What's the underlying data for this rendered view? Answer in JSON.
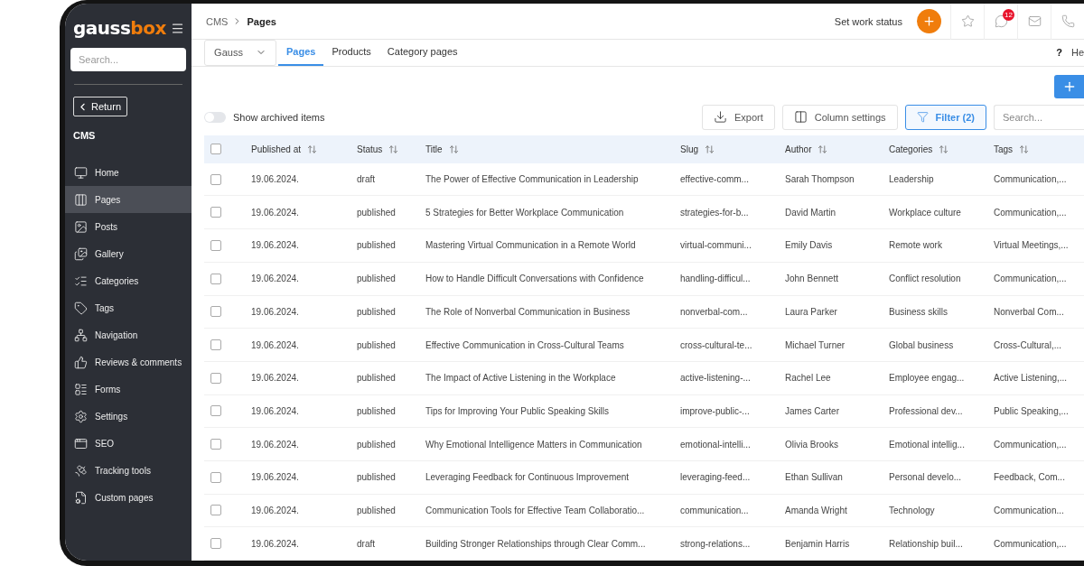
{
  "logo": {
    "text": "gauss",
    "accent": "box"
  },
  "sidebar": {
    "search": {
      "placeholder": "Search..."
    },
    "return_button": "Return",
    "section": "CMS",
    "items": [
      {
        "label": "Home",
        "selected": false
      },
      {
        "label": "Pages",
        "selected": true
      },
      {
        "label": "Posts",
        "selected": false
      },
      {
        "label": "Gallery",
        "selected": false
      },
      {
        "label": "Categories",
        "selected": false
      },
      {
        "label": "Tags",
        "selected": false
      },
      {
        "label": "Navigation",
        "selected": false
      },
      {
        "label": "Reviews & comments",
        "selected": false
      },
      {
        "label": "Forms",
        "selected": false
      },
      {
        "label": "Settings",
        "selected": false
      },
      {
        "label": "SEO",
        "selected": false
      },
      {
        "label": "Tracking tools",
        "selected": false
      },
      {
        "label": "Custom pages",
        "selected": false
      }
    ]
  },
  "breadcrumb": [
    "CMS",
    "Pages"
  ],
  "topbar": {
    "work_status": "Set work status",
    "messages_badge": "12"
  },
  "site_dropdown": {
    "value": "Gauss"
  },
  "tabs": [
    {
      "label": "Pages",
      "selected": true
    },
    {
      "label": "Products",
      "selected": false
    },
    {
      "label": "Category pages",
      "selected": false
    }
  ],
  "help": {
    "icon_text": "?",
    "label": "He"
  },
  "toolbar": {
    "archived_toggle": {
      "label": "Show archived items",
      "on": false
    },
    "export": "Export",
    "column_settings": "Column settings",
    "filter": {
      "label": "Filter (2)",
      "active": true
    },
    "search": {
      "placeholder": "Search..."
    }
  },
  "table": {
    "select_all": {
      "checked": false
    },
    "columns": [
      "Published at",
      "Status",
      "Title",
      "Slug",
      "Author",
      "Categories",
      "Tags"
    ],
    "rows": [
      {
        "checked": false,
        "cells": [
          "19.06.2024.",
          "draft",
          "The Power of Effective Communication in Leadership",
          "effective-comm...",
          "Sarah Thompson",
          "Leadership",
          "Communication,..."
        ]
      },
      {
        "checked": false,
        "cells": [
          "19.06.2024.",
          "published",
          "5 Strategies for Better Workplace Communication",
          "strategies-for-b...",
          "David Martin",
          "Workplace culture",
          "Communication,..."
        ]
      },
      {
        "checked": false,
        "cells": [
          "19.06.2024.",
          "published",
          "Mastering Virtual Communication in a Remote World",
          "virtual-communi...",
          "Emily Davis",
          "Remote work",
          "Virtual Meetings,..."
        ]
      },
      {
        "checked": false,
        "cells": [
          "19.06.2024.",
          "published",
          "How to Handle Difficult Conversations with Confidence",
          "handling-difficul...",
          "John Bennett",
          "Conflict resolution",
          "Communication,..."
        ]
      },
      {
        "checked": false,
        "cells": [
          "19.06.2024.",
          "published",
          "The Role of Nonverbal Communication in Business",
          "nonverbal-com...",
          "Laura Parker",
          "Business skills",
          "Nonverbal Com..."
        ]
      },
      {
        "checked": false,
        "cells": [
          "19.06.2024.",
          "published",
          "Effective Communication in Cross-Cultural Teams",
          "cross-cultural-te...",
          "Michael Turner",
          "Global business",
          "Cross-Cultural,..."
        ]
      },
      {
        "checked": false,
        "cells": [
          "19.06.2024.",
          "published",
          "The Impact of Active Listening in the Workplace",
          "active-listening-...",
          "Rachel Lee",
          "Employee engag...",
          "Active Listening,..."
        ]
      },
      {
        "checked": false,
        "cells": [
          "19.06.2024.",
          "published",
          "Tips for Improving Your Public Speaking Skills",
          "improve-public-...",
          "James Carter",
          "Professional dev...",
          "Public Speaking,..."
        ]
      },
      {
        "checked": false,
        "cells": [
          "19.06.2024.",
          "published",
          "Why Emotional Intelligence Matters in Communication",
          "emotional-intelli...",
          "Olivia Brooks",
          "Emotional intellig...",
          "Communication,..."
        ]
      },
      {
        "checked": false,
        "cells": [
          "19.06.2024.",
          "published",
          "Leveraging Feedback for Continuous Improvement",
          "leveraging-feed...",
          "Ethan Sullivan",
          "Personal develo...",
          "Feedback, Com..."
        ]
      },
      {
        "checked": false,
        "cells": [
          "19.06.2024.",
          "published",
          "Communication Tools for Effective Team Collaboratio...",
          "communication...",
          "Amanda Wright",
          "Technology",
          "Communication..."
        ]
      },
      {
        "checked": false,
        "cells": [
          "19.06.2024.",
          "draft",
          "Building Stronger Relationships through Clear Comm...",
          "strong-relations...",
          "Benjamin Harris",
          "Relationship buil...",
          "Communication,..."
        ]
      }
    ]
  }
}
